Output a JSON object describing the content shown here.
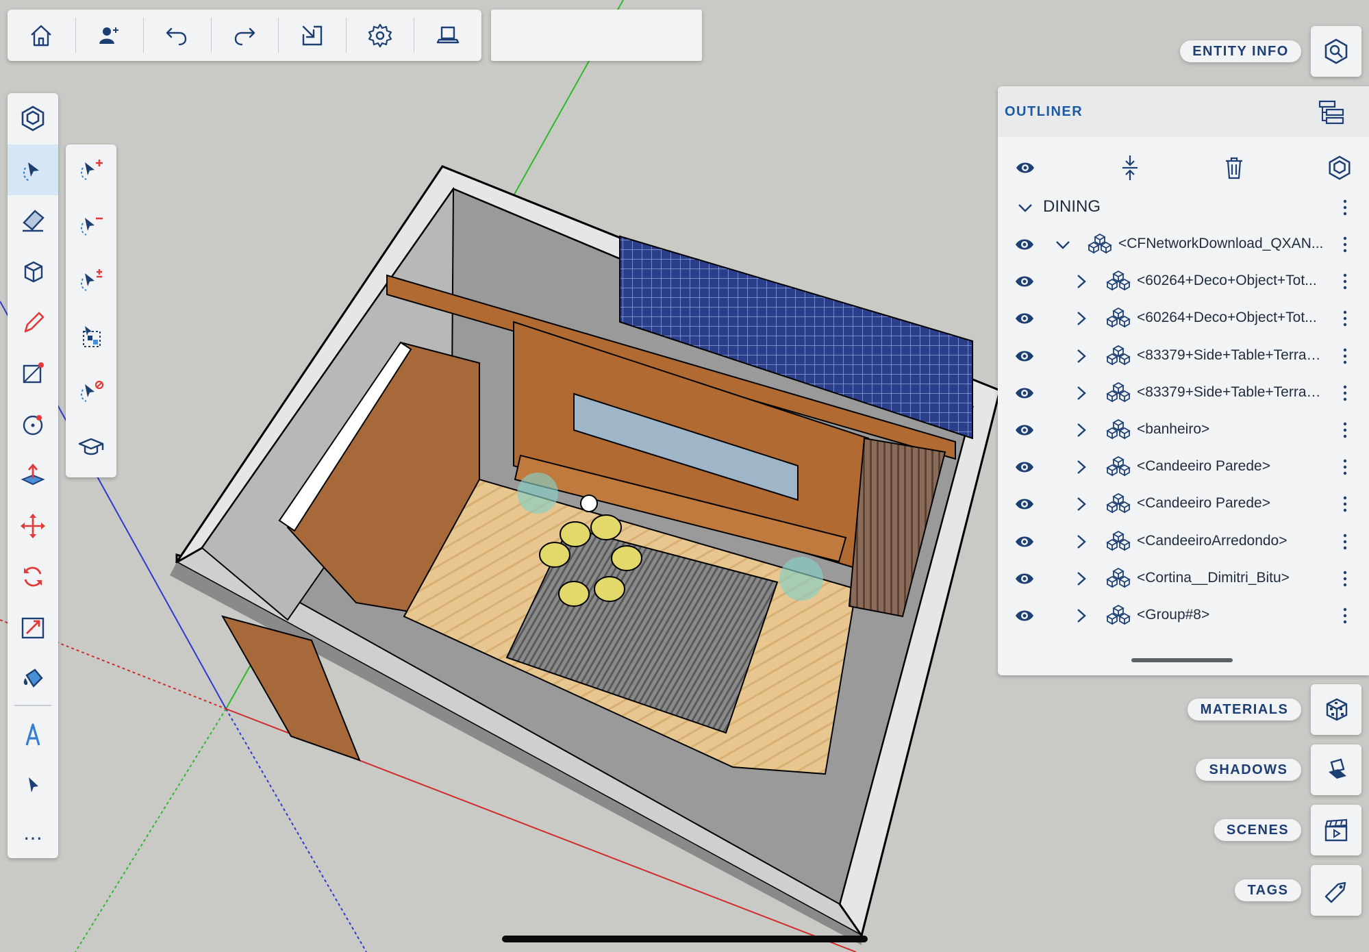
{
  "top_toolbar": {
    "buttons": [
      {
        "name": "home-icon"
      },
      {
        "name": "add-user-icon"
      },
      {
        "name": "undo-icon"
      },
      {
        "name": "redo-icon"
      },
      {
        "name": "export-icon"
      },
      {
        "name": "gear-icon"
      },
      {
        "name": "display-icon"
      }
    ],
    "input_value": ""
  },
  "left_toolbar": {
    "tools": [
      "component-icon",
      "select-tool-icon",
      "eraser-icon",
      "box-icon",
      "pencil-icon",
      "rectangle-icon",
      "circle-icon",
      "push-pull-icon",
      "move-icon",
      "rotate-icon",
      "scale-icon",
      "paint-bucket-icon",
      "text-icon",
      "arrow-pointer-icon",
      "more-icon"
    ],
    "more_label": "…"
  },
  "sub_toolbar": {
    "tools": [
      "select-add-icon",
      "select-subtract-icon",
      "select-toggle-icon",
      "select-all-icon",
      "select-none-icon",
      "graduation-cap-icon"
    ]
  },
  "right_panel": {
    "entity_info_label": "ENTITY INFO",
    "materials_label": "MATERIALS",
    "shadows_label": "SHADOWS",
    "scenes_label": "SCENES",
    "tags_label": "TAGS"
  },
  "outliner": {
    "title": "OUTLINER",
    "root": "DINING",
    "items": [
      {
        "label": "<CFNetworkDownload_QXAN...",
        "level": 1,
        "expanded": true
      },
      {
        "label": "<60264+Deco+Object+Tot...",
        "level": 2
      },
      {
        "label": "<60264+Deco+Object+Tot...",
        "level": 2
      },
      {
        "label": "<83379+Side+Table+Terraz...",
        "level": 2
      },
      {
        "label": "<83379+Side+Table+Terraz...",
        "level": 2
      },
      {
        "label": "<banheiro>",
        "level": 2
      },
      {
        "label": "<Candeeiro Parede>",
        "level": 2
      },
      {
        "label": "<Candeeiro Parede>",
        "level": 2
      },
      {
        "label": "<CandeeiroArredondo>",
        "level": 2
      },
      {
        "label": "<Cortina__Dimitri_Bitu>",
        "level": 2
      },
      {
        "label": "<Group#8>",
        "level": 2
      }
    ]
  },
  "colors": {
    "accent": "#1d3f73",
    "outliner_title": "#1d5aa6",
    "panel": "#f2f3f4",
    "background": "#c9c9c6"
  }
}
